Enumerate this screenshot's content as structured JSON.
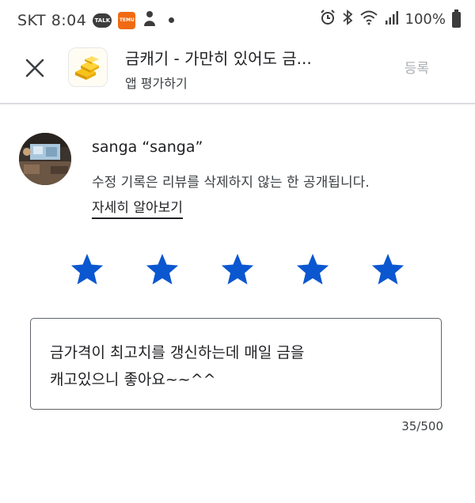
{
  "status_bar": {
    "carrier_time": "SKT 8:04",
    "talk_badge": "TALK",
    "temu_badge": "TEMU",
    "battery": "100%"
  },
  "header": {
    "app_title": "금캐기 - 가만히 있어도 금...",
    "subtitle": "앱 평가하기",
    "submit_label": "등록"
  },
  "reviewer": {
    "name": "sanga “sanga”",
    "notice": "수정 기록은 리뷰를 삭제하지 않는 한 공개됩니다.",
    "learn_more": "자세히 알아보기"
  },
  "rating": {
    "value": 5,
    "max": 5,
    "star_color": "#0b57d0"
  },
  "review": {
    "text": "금가격이 최고치를 갱신하는데 매일 금을\n캐고있으니 좋아요~~^^",
    "counter": "35/500"
  },
  "icons": {
    "close": "close-icon",
    "star": "star-icon",
    "app": "gold-bars-icon"
  }
}
